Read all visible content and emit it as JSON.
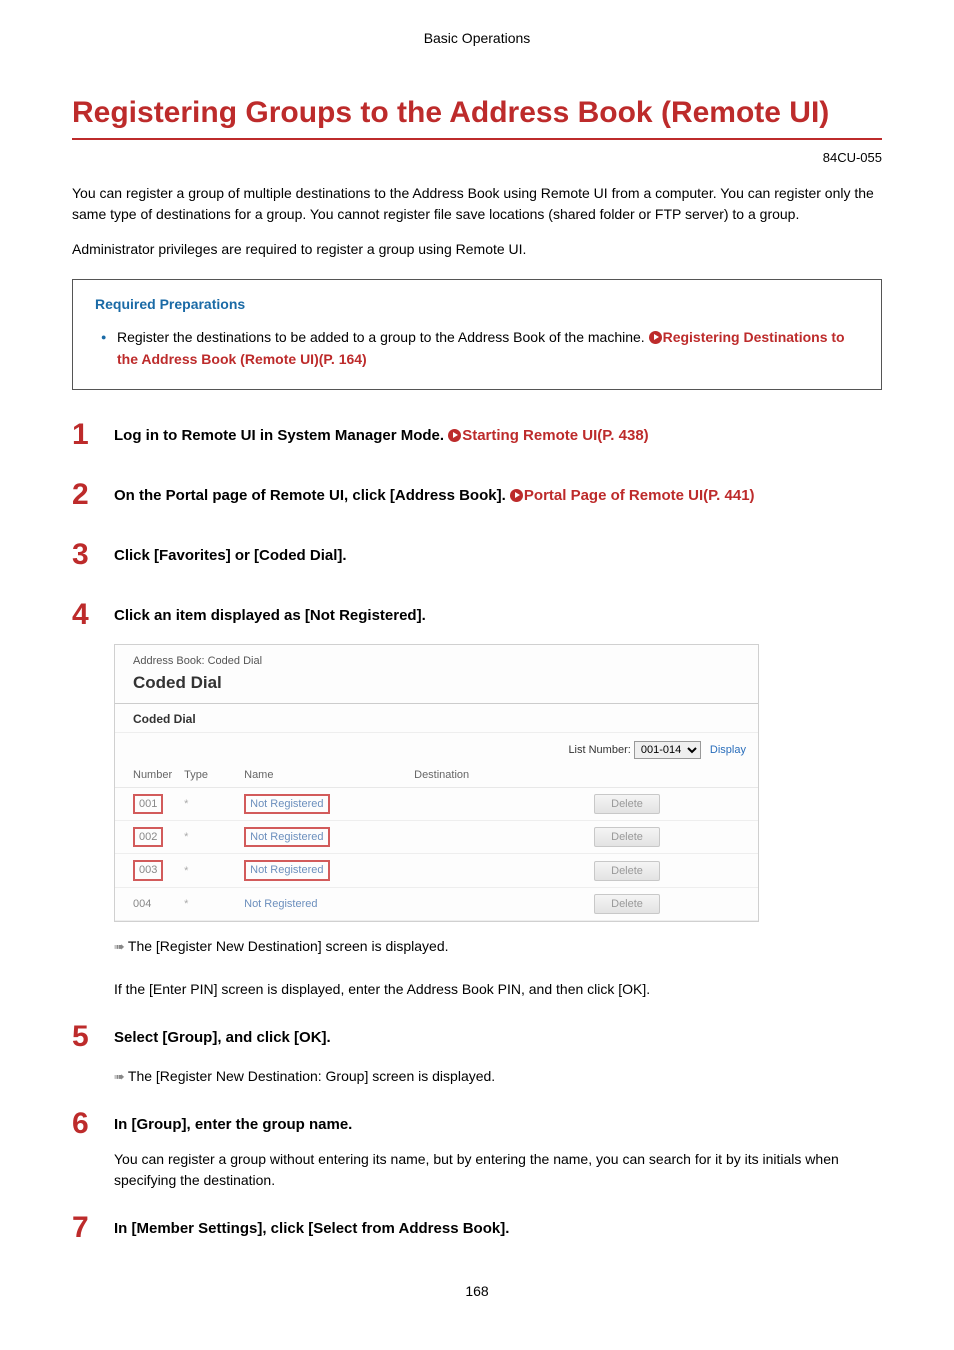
{
  "header": "Basic Operations",
  "title": "Registering Groups to the Address Book (Remote UI)",
  "doc_id": "84CU-055",
  "intro": "You can register a group of multiple destinations to the Address Book using Remote UI from a computer. You can register only the same type of destinations for a group. You cannot register file save locations (shared folder or FTP server) to a group.",
  "admin_note": "Administrator privileges are required to register a group using Remote UI.",
  "req": {
    "heading": "Required Preparations",
    "bullet_text": "Register the destinations to be added to a group to the Address Book of the machine. ",
    "bullet_link": "Registering Destinations to the Address Book (Remote UI)(P. 164)"
  },
  "steps": [
    {
      "n": "1",
      "title_pre": "Log in to Remote UI in System Manager Mode. ",
      "title_link": "Starting Remote UI(P. 438)"
    },
    {
      "n": "2",
      "title_pre": "On the Portal page of Remote UI, click [Address Book]. ",
      "title_link": "Portal Page of Remote UI(P. 441)"
    },
    {
      "n": "3",
      "title_pre": "Click [Favorites] or [Coded Dial].",
      "title_link": ""
    },
    {
      "n": "4",
      "title_pre": "Click an item displayed as [Not Registered].",
      "title_link": ""
    },
    {
      "n": "5",
      "title_pre": "Select [Group], and click [OK].",
      "title_link": ""
    },
    {
      "n": "6",
      "title_pre": "In [Group], enter the group name.",
      "title_link": ""
    },
    {
      "n": "7",
      "title_pre": "In [Member Settings], click [Select from Address Book].",
      "title_link": ""
    }
  ],
  "result4a": "The [Register New Destination] screen is displayed.",
  "result4b": "If the [Enter PIN] screen is displayed, enter the Address Book PIN, and then click [OK].",
  "result5": "The [Register New Destination: Group] screen is displayed.",
  "detail6": "You can register a group without entering its name, but by entering the name, you can search for it by its initials when specifying the destination.",
  "screenshot": {
    "breadcrumb": "Address Book: Coded Dial",
    "h1": "Coded Dial",
    "h2": "Coded Dial",
    "list_label": "List Number:",
    "list_value": "001-014",
    "display": "Display",
    "cols": {
      "num": "Number",
      "type": "Type",
      "name": "Name",
      "dest": "Destination"
    },
    "rows": [
      {
        "num": "001",
        "type": "*",
        "name": "Not Registered",
        "del": "Delete"
      },
      {
        "num": "002",
        "type": "*",
        "name": "Not Registered",
        "del": "Delete"
      },
      {
        "num": "003",
        "type": "*",
        "name": "Not Registered",
        "del": "Delete"
      },
      {
        "num": "004",
        "type": "*",
        "name": "Not Registered",
        "del": "Delete"
      }
    ]
  },
  "page_num": "168"
}
